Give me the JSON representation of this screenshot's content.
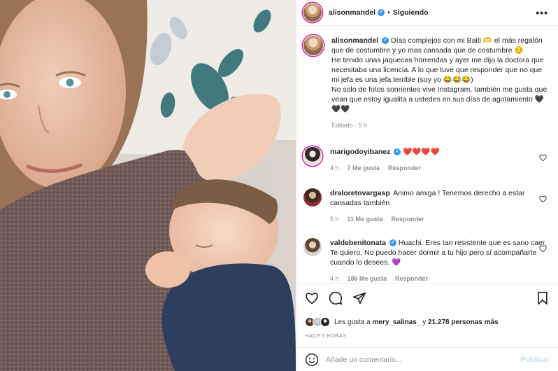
{
  "header": {
    "username": "alisonmandel",
    "separator": "•",
    "following_label": "Siguiendo",
    "more_label": "•••"
  },
  "caption": {
    "username": "alisonmandel",
    "text": "Días complejos con mi Baiti 🫶 el más regalón que de costumbre y yo mas cansada que de costumbre 😔\nHe tenido unas jaquecas horrendas y ayer me dijo la doctora que necesitaba una licencia. A lo que tuve que responder que no que mi jefa es una jefa terrible (soy yo 😂😂😂)\nNo solo de fotos sonrientes vive Instagram, también me gusta que vean que estoy igualita a ustedes en sus días de agotamiento 🖤🖤🖤",
    "edited": "Editado · 5 h"
  },
  "comments": [
    {
      "username": "marigodoyibanez",
      "verified": true,
      "text": "❤️❤️❤️❤️",
      "time": "4 h",
      "likes": "7 Me gusta",
      "reply": "Responder"
    },
    {
      "username": "draloretovargasp",
      "verified": false,
      "text": "Animo amiga ! Tenemos derecho a estar cansadas también",
      "time": "5 h",
      "likes": "11 Me gusta",
      "reply": "Responder"
    },
    {
      "username": "valdebenitonata",
      "verified": true,
      "text": "Huachi. Eres tan resistente que es sano caer. Te quiero. No puedo hacer dormir a tu hijo pero sí acompañarte cuando lo desees. 💜",
      "time": "4 h",
      "likes": "186 Me gusta",
      "reply": "Responder"
    }
  ],
  "likes": {
    "prefix": "Les gusta a ",
    "user": "mery_salinas_",
    "middle": " y ",
    "count": "21.278 personas más"
  },
  "timestamp": "HACE 5 HORAS",
  "add_comment": {
    "placeholder": "Añade un comentario...",
    "post_label": "Publicar"
  },
  "colors": {
    "verified": "#3897f0",
    "heart_red": "#ed4956",
    "muted": "#8e8e8e",
    "post_disabled": "#b2dffc"
  }
}
